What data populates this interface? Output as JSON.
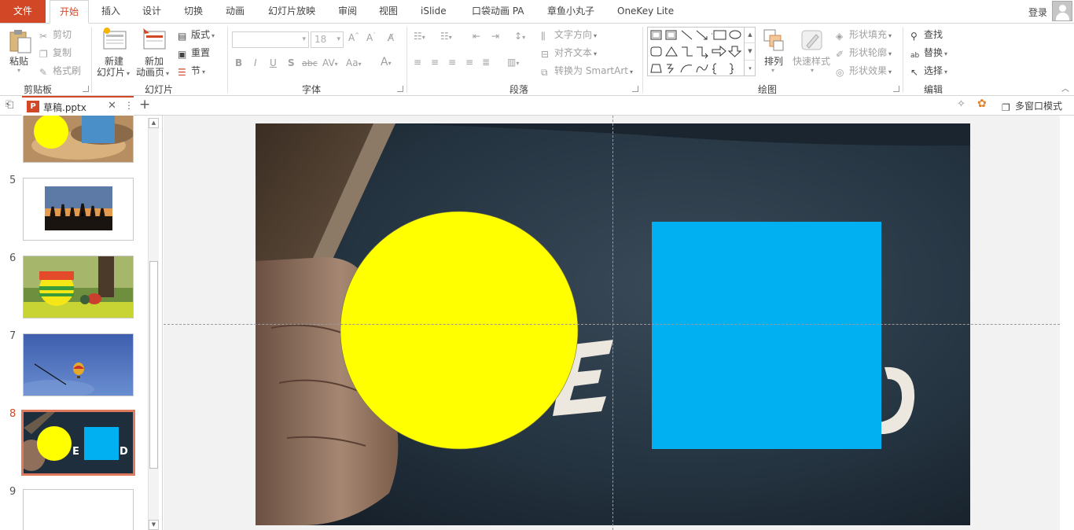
{
  "menu": {
    "file": "文件",
    "tabs": [
      "开始",
      "插入",
      "设计",
      "切换",
      "动画",
      "幻灯片放映",
      "审阅",
      "视图",
      "iSlide",
      "口袋动画 PA",
      "章鱼小丸子",
      "OneKey Lite"
    ],
    "login": "登录"
  },
  "ribbon": {
    "clipboard": {
      "paste": "粘贴",
      "cut": "剪切",
      "copy": "复制",
      "format_painter": "格式刷",
      "label": "剪贴板"
    },
    "slides": {
      "new_slide_1": "新建",
      "new_slide_2": "幻灯片",
      "new_anim_1": "新加",
      "new_anim_2": "动画页",
      "layout": "版式",
      "reset": "重置",
      "section": "节",
      "label": "幻灯片"
    },
    "font": {
      "font_size": "18",
      "label": "字体"
    },
    "paragraph": {
      "text_direction": "文字方向",
      "align_text": "对齐文本",
      "convert_smartart": "转换为 SmartArt",
      "label": "段落"
    },
    "drawing": {
      "arrange": "排列",
      "quick_styles": "快速样式",
      "shape_fill": "形状填充",
      "shape_outline": "形状轮廓",
      "shape_effects": "形状效果",
      "label": "绘图"
    },
    "editing": {
      "find": "查找",
      "replace": "替换",
      "select": "选择",
      "label": "编辑"
    }
  },
  "docbar": {
    "filename": "草稿.pptx",
    "multi_window": "多窗口模式"
  },
  "thumbnails": [
    {
      "number": "5"
    },
    {
      "number": "6"
    },
    {
      "number": "7"
    },
    {
      "number": "8"
    },
    {
      "number": "9"
    }
  ],
  "colors": {
    "accent": "#d24726",
    "circle": "#ffff00",
    "square": "#00b0f0"
  }
}
